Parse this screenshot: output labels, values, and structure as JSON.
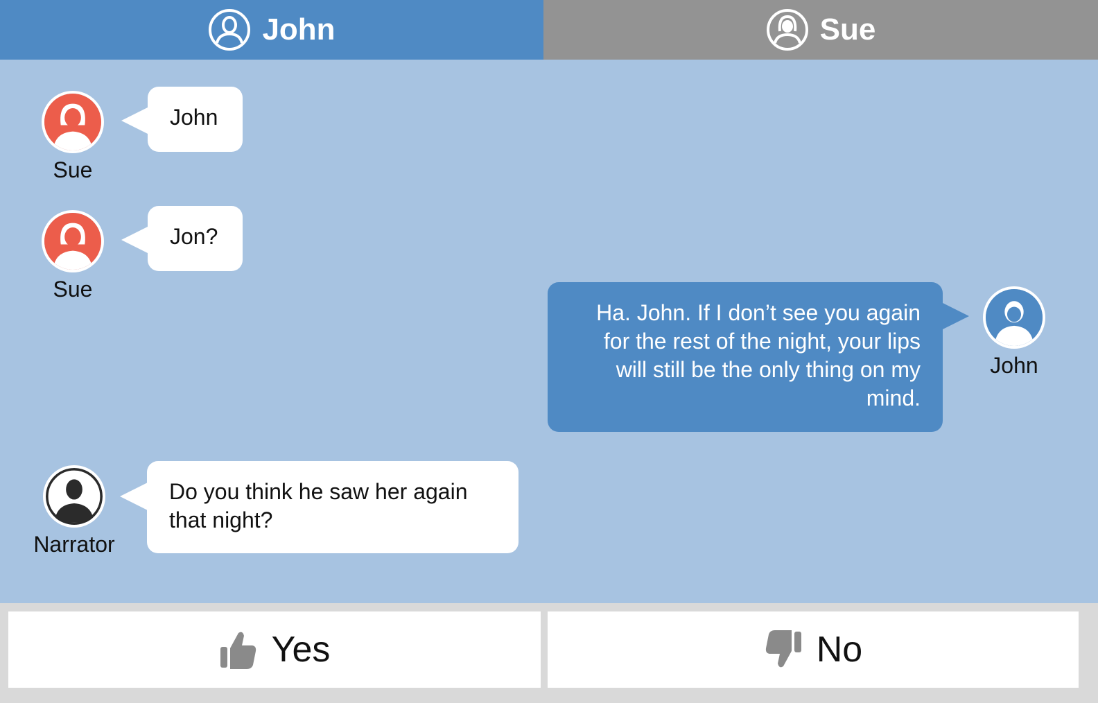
{
  "tabs": [
    {
      "label": "John",
      "icon": "user-male-icon",
      "active": true
    },
    {
      "label": "Sue",
      "icon": "user-female-icon",
      "active": false
    }
  ],
  "messages": [
    {
      "speaker": "Sue",
      "text": "John",
      "side": "left",
      "avatar": "user-female-icon"
    },
    {
      "speaker": "Sue",
      "text": "Jon?",
      "side": "left",
      "avatar": "user-female-icon"
    },
    {
      "speaker": "John",
      "text": "Ha. John. If I don’t see you again for the rest of the night, your lips will still be the only thing on my mind.",
      "side": "right",
      "avatar": "user-male-icon"
    },
    {
      "speaker": "Narrator",
      "text": "Do you think he saw her again that night?",
      "side": "left",
      "avatar": "narrator-icon"
    }
  ],
  "actions": {
    "yes_label": "Yes",
    "no_label": "No"
  },
  "colors": {
    "active_tab": "#4f8ac4",
    "inactive_tab": "#939393",
    "chat_bg": "#a7c3e1",
    "sue_avatar": "#ec5d4b",
    "john_avatar": "#4f8ac4",
    "narrator_avatar": "#2b2b2b"
  }
}
